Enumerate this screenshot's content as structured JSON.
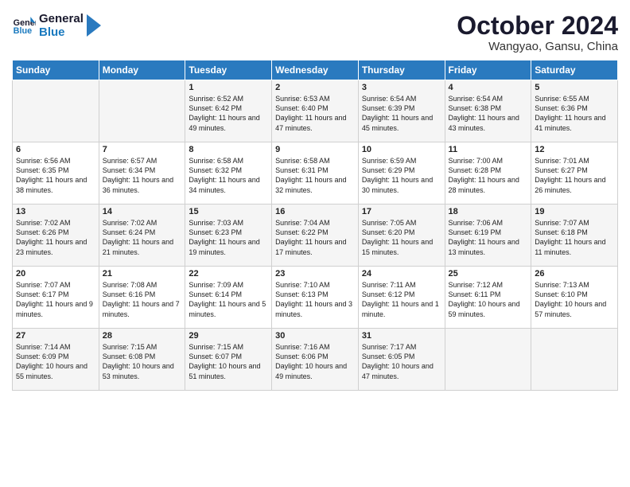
{
  "header": {
    "logo_general": "General",
    "logo_blue": "Blue",
    "month": "October 2024",
    "location": "Wangyao, Gansu, China"
  },
  "days_of_week": [
    "Sunday",
    "Monday",
    "Tuesday",
    "Wednesday",
    "Thursday",
    "Friday",
    "Saturday"
  ],
  "weeks": [
    [
      {
        "day": "",
        "info": ""
      },
      {
        "day": "",
        "info": ""
      },
      {
        "day": "1",
        "info": "Sunrise: 6:52 AM\nSunset: 6:42 PM\nDaylight: 11 hours and 49 minutes."
      },
      {
        "day": "2",
        "info": "Sunrise: 6:53 AM\nSunset: 6:40 PM\nDaylight: 11 hours and 47 minutes."
      },
      {
        "day": "3",
        "info": "Sunrise: 6:54 AM\nSunset: 6:39 PM\nDaylight: 11 hours and 45 minutes."
      },
      {
        "day": "4",
        "info": "Sunrise: 6:54 AM\nSunset: 6:38 PM\nDaylight: 11 hours and 43 minutes."
      },
      {
        "day": "5",
        "info": "Sunrise: 6:55 AM\nSunset: 6:36 PM\nDaylight: 11 hours and 41 minutes."
      }
    ],
    [
      {
        "day": "6",
        "info": "Sunrise: 6:56 AM\nSunset: 6:35 PM\nDaylight: 11 hours and 38 minutes."
      },
      {
        "day": "7",
        "info": "Sunrise: 6:57 AM\nSunset: 6:34 PM\nDaylight: 11 hours and 36 minutes."
      },
      {
        "day": "8",
        "info": "Sunrise: 6:58 AM\nSunset: 6:32 PM\nDaylight: 11 hours and 34 minutes."
      },
      {
        "day": "9",
        "info": "Sunrise: 6:58 AM\nSunset: 6:31 PM\nDaylight: 11 hours and 32 minutes."
      },
      {
        "day": "10",
        "info": "Sunrise: 6:59 AM\nSunset: 6:29 PM\nDaylight: 11 hours and 30 minutes."
      },
      {
        "day": "11",
        "info": "Sunrise: 7:00 AM\nSunset: 6:28 PM\nDaylight: 11 hours and 28 minutes."
      },
      {
        "day": "12",
        "info": "Sunrise: 7:01 AM\nSunset: 6:27 PM\nDaylight: 11 hours and 26 minutes."
      }
    ],
    [
      {
        "day": "13",
        "info": "Sunrise: 7:02 AM\nSunset: 6:26 PM\nDaylight: 11 hours and 23 minutes."
      },
      {
        "day": "14",
        "info": "Sunrise: 7:02 AM\nSunset: 6:24 PM\nDaylight: 11 hours and 21 minutes."
      },
      {
        "day": "15",
        "info": "Sunrise: 7:03 AM\nSunset: 6:23 PM\nDaylight: 11 hours and 19 minutes."
      },
      {
        "day": "16",
        "info": "Sunrise: 7:04 AM\nSunset: 6:22 PM\nDaylight: 11 hours and 17 minutes."
      },
      {
        "day": "17",
        "info": "Sunrise: 7:05 AM\nSunset: 6:20 PM\nDaylight: 11 hours and 15 minutes."
      },
      {
        "day": "18",
        "info": "Sunrise: 7:06 AM\nSunset: 6:19 PM\nDaylight: 11 hours and 13 minutes."
      },
      {
        "day": "19",
        "info": "Sunrise: 7:07 AM\nSunset: 6:18 PM\nDaylight: 11 hours and 11 minutes."
      }
    ],
    [
      {
        "day": "20",
        "info": "Sunrise: 7:07 AM\nSunset: 6:17 PM\nDaylight: 11 hours and 9 minutes."
      },
      {
        "day": "21",
        "info": "Sunrise: 7:08 AM\nSunset: 6:16 PM\nDaylight: 11 hours and 7 minutes."
      },
      {
        "day": "22",
        "info": "Sunrise: 7:09 AM\nSunset: 6:14 PM\nDaylight: 11 hours and 5 minutes."
      },
      {
        "day": "23",
        "info": "Sunrise: 7:10 AM\nSunset: 6:13 PM\nDaylight: 11 hours and 3 minutes."
      },
      {
        "day": "24",
        "info": "Sunrise: 7:11 AM\nSunset: 6:12 PM\nDaylight: 11 hours and 1 minute."
      },
      {
        "day": "25",
        "info": "Sunrise: 7:12 AM\nSunset: 6:11 PM\nDaylight: 10 hours and 59 minutes."
      },
      {
        "day": "26",
        "info": "Sunrise: 7:13 AM\nSunset: 6:10 PM\nDaylight: 10 hours and 57 minutes."
      }
    ],
    [
      {
        "day": "27",
        "info": "Sunrise: 7:14 AM\nSunset: 6:09 PM\nDaylight: 10 hours and 55 minutes."
      },
      {
        "day": "28",
        "info": "Sunrise: 7:15 AM\nSunset: 6:08 PM\nDaylight: 10 hours and 53 minutes."
      },
      {
        "day": "29",
        "info": "Sunrise: 7:15 AM\nSunset: 6:07 PM\nDaylight: 10 hours and 51 minutes."
      },
      {
        "day": "30",
        "info": "Sunrise: 7:16 AM\nSunset: 6:06 PM\nDaylight: 10 hours and 49 minutes."
      },
      {
        "day": "31",
        "info": "Sunrise: 7:17 AM\nSunset: 6:05 PM\nDaylight: 10 hours and 47 minutes."
      },
      {
        "day": "",
        "info": ""
      },
      {
        "day": "",
        "info": ""
      }
    ]
  ]
}
